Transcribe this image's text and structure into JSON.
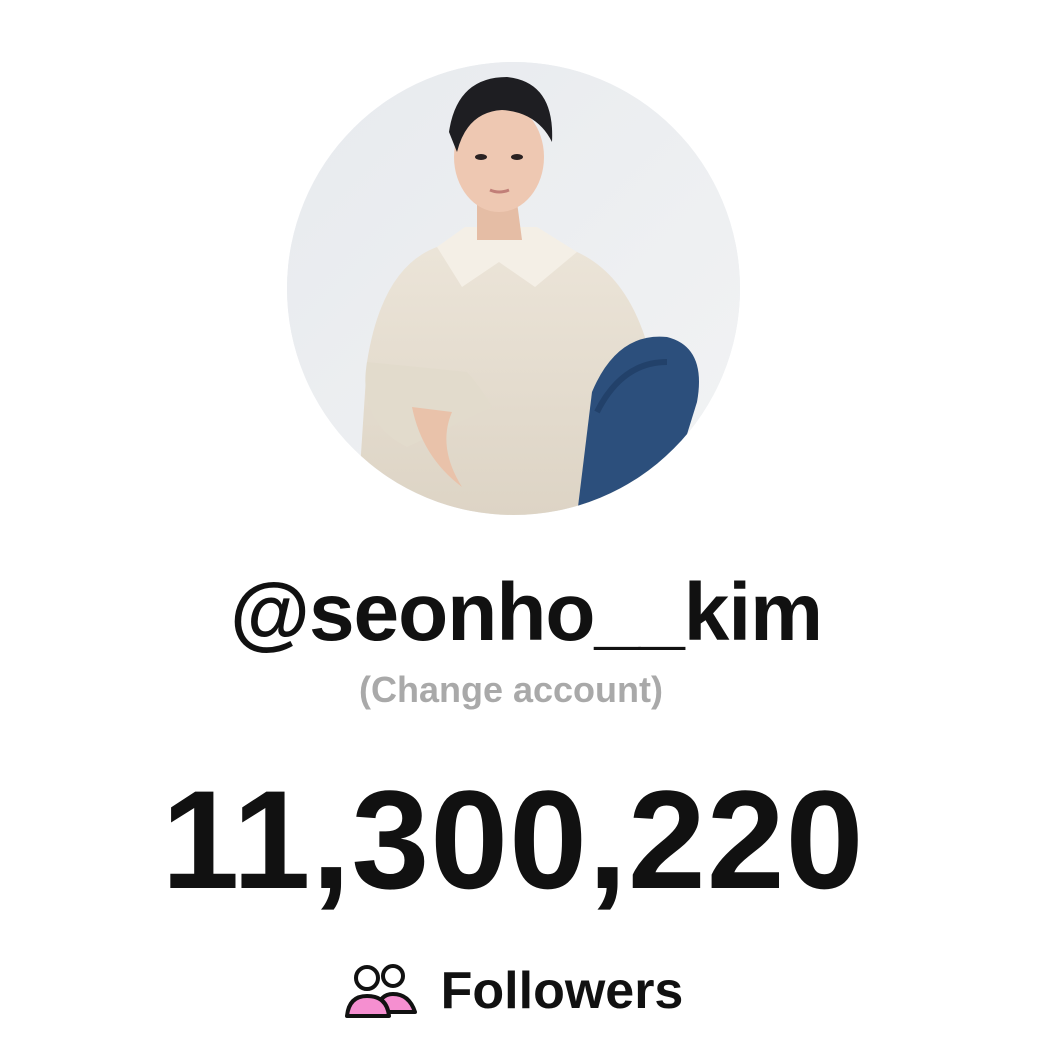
{
  "profile": {
    "username": "@seonho__kim",
    "change_account_label": "(Change account)",
    "avatar_icon": "profile-photo"
  },
  "stats": {
    "followers_count": "11,300,220",
    "followers_label": "Followers",
    "followers_icon": "people-icon"
  },
  "colors": {
    "text_primary": "#111111",
    "text_secondary": "#a9a9a9",
    "icon_accent": "#f58fd0",
    "background": "#ffffff"
  }
}
